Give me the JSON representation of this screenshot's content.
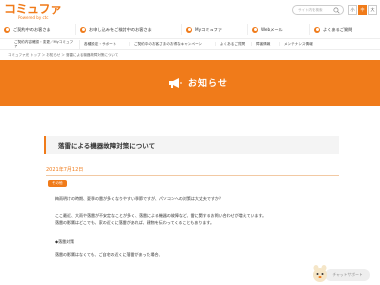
{
  "header": {
    "logo_main": "コミュファ",
    "logo_sub": "Powered by ctc",
    "search_placeholder": "サイト内を検索",
    "font_sizes": [
      "小",
      "中",
      "大"
    ],
    "font_size_active": 1
  },
  "mainnav": [
    {
      "label": "ご契約中のお客さま",
      "icon": "person-icon"
    },
    {
      "label": "お申し込みをご検討中のお客さま",
      "icon": "home-icon"
    },
    {
      "label": "Myコミュファ",
      "icon": "heart-icon"
    },
    {
      "label": "Webメール",
      "icon": "mail-icon"
    },
    {
      "label": "よくあるご質問",
      "icon": "question-icon"
    }
  ],
  "subnav": [
    {
      "label": "ご契約内容確認・変更／Myコミュファ"
    },
    {
      "label": "各種設定・サポート"
    },
    {
      "label": "ご契約中のお客さまのお得なキャンペーン"
    },
    {
      "label": "よくあるご質問"
    },
    {
      "label": "障害情報"
    },
    {
      "label": "メンテナンス情報"
    }
  ],
  "breadcrumb": "コミュファ光 トップ ＞ お知らせ ＞ 落雷による機器故障対策について",
  "hero": {
    "title": "お知らせ",
    "icon": "megaphone-icon"
  },
  "article": {
    "title": "落雷による機器故障対策について",
    "date": "2021年7月12日",
    "category": "その他",
    "paragraphs": [
      "梅雨明けの時期、夏季の雷が多くなりやすい季節ですが、パソコンへの対策は大丈夫ですか？",
      "ここ最近、大雨や落雷が不安定なことが多く、落雷による機器の故障など、雷に関するお問い合わせが増えています。",
      "落雷の影響はどこでも、家の近くに落雷があれば、建物を伝わってくることもあります。",
      "◆落雷対策",
      "落雷の影響はなくても、ご自宅の近くに落雷があった場合、"
    ]
  },
  "chara": {
    "label": "チャットサポート",
    "icon": "character-icon"
  }
}
